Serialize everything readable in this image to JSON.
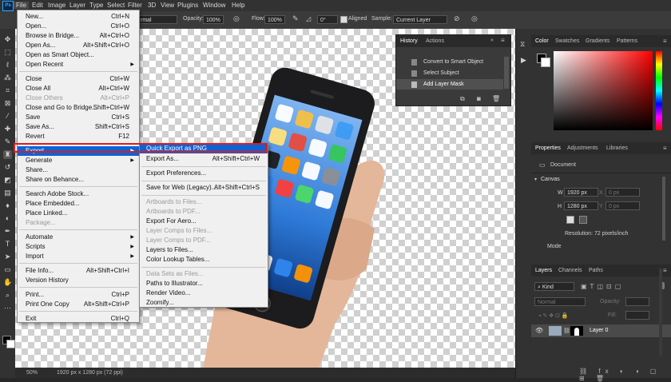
{
  "app": {
    "logo": "Ps"
  },
  "menubar": [
    "File",
    "Edit",
    "Image",
    "Layer",
    "Type",
    "Select",
    "Filter",
    "3D",
    "View",
    "Plugins",
    "Window",
    "Help"
  ],
  "options": {
    "mode_value": "rmal",
    "opacity_label": "Opacity:",
    "opacity_value": "100%",
    "flow_label": "Flow:",
    "flow_value": "100%",
    "zero_value": "0°",
    "aligned_label": "Aligned",
    "sample_label": "Sample:",
    "sample_value": "Current Layer"
  },
  "file_menu": {
    "items": [
      {
        "label": "New...",
        "shortcut": "Ctrl+N",
        "disabled": false,
        "submenu": false
      },
      {
        "label": "Open...",
        "shortcut": "Ctrl+O",
        "disabled": false,
        "submenu": false
      },
      {
        "label": "Browse in Bridge...",
        "shortcut": "Alt+Ctrl+O",
        "disabled": false,
        "submenu": false
      },
      {
        "label": "Open As...",
        "shortcut": "Alt+Shift+Ctrl+O",
        "disabled": false,
        "submenu": false
      },
      {
        "label": "Open as Smart Object...",
        "shortcut": "",
        "disabled": false,
        "submenu": false
      },
      {
        "label": "Open Recent",
        "shortcut": "",
        "disabled": false,
        "submenu": true
      },
      {
        "label": "Close",
        "shortcut": "Ctrl+W",
        "disabled": false,
        "submenu": false
      },
      {
        "label": "Close All",
        "shortcut": "Alt+Ctrl+W",
        "disabled": false,
        "submenu": false
      },
      {
        "label": "Close Others",
        "shortcut": "Alt+Ctrl+P",
        "disabled": true,
        "submenu": false
      },
      {
        "label": "Close and Go to Bridge...",
        "shortcut": "Shift+Ctrl+W",
        "disabled": false,
        "submenu": false
      },
      {
        "label": "Save",
        "shortcut": "Ctrl+S",
        "disabled": false,
        "submenu": false
      },
      {
        "label": "Save As...",
        "shortcut": "Shift+Ctrl+S",
        "disabled": false,
        "submenu": false
      },
      {
        "label": "Revert",
        "shortcut": "F12",
        "disabled": false,
        "submenu": false
      },
      {
        "label": "Export",
        "shortcut": "",
        "disabled": false,
        "submenu": true
      },
      {
        "label": "Generate",
        "shortcut": "",
        "disabled": false,
        "submenu": true
      },
      {
        "label": "Share...",
        "shortcut": "",
        "disabled": false,
        "submenu": false
      },
      {
        "label": "Share on Behance...",
        "shortcut": "",
        "disabled": false,
        "submenu": false
      },
      {
        "label": "Search Adobe Stock...",
        "shortcut": "",
        "disabled": false,
        "submenu": false
      },
      {
        "label": "Place Embedded...",
        "shortcut": "",
        "disabled": false,
        "submenu": false
      },
      {
        "label": "Place Linked...",
        "shortcut": "",
        "disabled": false,
        "submenu": false
      },
      {
        "label": "Package...",
        "shortcut": "",
        "disabled": true,
        "submenu": false
      },
      {
        "label": "Automate",
        "shortcut": "",
        "disabled": false,
        "submenu": true
      },
      {
        "label": "Scripts",
        "shortcut": "",
        "disabled": false,
        "submenu": true
      },
      {
        "label": "Import",
        "shortcut": "",
        "disabled": false,
        "submenu": true
      },
      {
        "label": "File Info...",
        "shortcut": "Alt+Shift+Ctrl+I",
        "disabled": false,
        "submenu": false
      },
      {
        "label": "Version History",
        "shortcut": "",
        "disabled": false,
        "submenu": false
      },
      {
        "label": "Print...",
        "shortcut": "Ctrl+P",
        "disabled": false,
        "submenu": false
      },
      {
        "label": "Print One Copy",
        "shortcut": "Alt+Shift+Ctrl+P",
        "disabled": false,
        "submenu": false
      },
      {
        "label": "Exit",
        "shortcut": "Ctrl+Q",
        "disabled": false,
        "submenu": false
      }
    ]
  },
  "export_menu": {
    "items": [
      {
        "label": "Quick Export as PNG",
        "shortcut": "",
        "disabled": false
      },
      {
        "label": "Export As...",
        "shortcut": "Alt+Shift+Ctrl+W",
        "disabled": false
      },
      {
        "label": "Export Preferences...",
        "shortcut": "",
        "disabled": false
      },
      {
        "label": "Save for Web (Legacy)...",
        "shortcut": "Alt+Shift+Ctrl+S",
        "disabled": false
      },
      {
        "label": "Artboards to Files...",
        "shortcut": "",
        "disabled": true
      },
      {
        "label": "Artboards to PDF...",
        "shortcut": "",
        "disabled": true
      },
      {
        "label": "Export For Aero...",
        "shortcut": "",
        "disabled": false
      },
      {
        "label": "Layer Comps to Files...",
        "shortcut": "",
        "disabled": true
      },
      {
        "label": "Layer Comps to PDF...",
        "shortcut": "",
        "disabled": true
      },
      {
        "label": "Layers to Files...",
        "shortcut": "",
        "disabled": false
      },
      {
        "label": "Color Lookup Tables...",
        "shortcut": "",
        "disabled": false
      },
      {
        "label": "Data Sets as Files...",
        "shortcut": "",
        "disabled": true
      },
      {
        "label": "Paths to Illustrator...",
        "shortcut": "",
        "disabled": false
      },
      {
        "label": "Render Video...",
        "shortcut": "",
        "disabled": false
      },
      {
        "label": "Zoomify...",
        "shortcut": "",
        "disabled": false
      }
    ]
  },
  "history_panel": {
    "tabs": [
      "History",
      "Actions"
    ],
    "items": [
      "Convert to Smart Object",
      "Select Subject",
      "Add Layer Mask"
    ]
  },
  "color_panel": {
    "tabs": [
      "Color",
      "Swatches",
      "Gradients",
      "Patterns"
    ]
  },
  "properties_panel": {
    "tabs": [
      "Properties",
      "Adjustments",
      "Libraries"
    ],
    "document_label": "Document",
    "canvas_label": "Canvas",
    "w_label": "W",
    "w_value": "1920 px",
    "x_label": "X",
    "x_value": "0 px",
    "h_label": "H",
    "h_value": "1280 px",
    "y_label": "Y",
    "y_value": "0 px",
    "resolution": "Resolution: 72 pixels/inch",
    "mode_label": "Mode"
  },
  "layers_panel": {
    "tabs": [
      "Layers",
      "Channels",
      "Paths"
    ],
    "kind_label": "Kind",
    "blend_mode": "Normal",
    "opacity_label": "Opacity:",
    "fill_label": "Fill:",
    "layer_name": "Layer 0"
  },
  "status": {
    "zoom": "50%",
    "doc_size": "1920 px x 1280 px (72 ppi)"
  },
  "colors": {
    "highlight": "#0a64d6",
    "export_box": "#e01b1b",
    "menu_bg": "#f0f0f0"
  }
}
